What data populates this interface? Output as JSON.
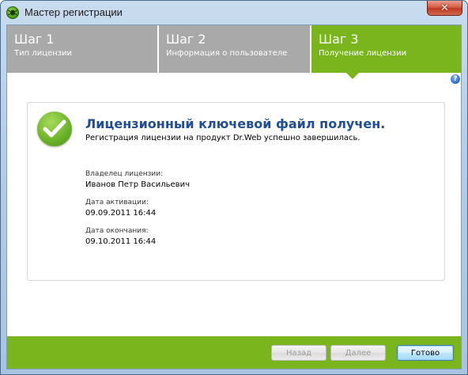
{
  "window": {
    "title": "Мастер регистрации",
    "close_glyph": "✕"
  },
  "steps": [
    {
      "number": "Шаг 1",
      "label": "Тип лицензии",
      "active": false
    },
    {
      "number": "Шаг 2",
      "label": "Информация о пользователе",
      "active": false
    },
    {
      "number": "Шаг 3",
      "label": "Получение лицензии",
      "active": true
    }
  ],
  "help": {
    "glyph": "?"
  },
  "result": {
    "heading": "Лицензионный ключевой файл получен.",
    "subheading": "Регистрация лицензии на продукт Dr.Web успешно завершилась.",
    "owner_label": "Владелец лицензии:",
    "owner_value": "Иванов Петр Васильевич",
    "activation_label": "Дата активации:",
    "activation_value": "09.09.2011 16:44",
    "expiry_label": "Дата окончания:",
    "expiry_value": "09.10.2011 16:44"
  },
  "footer": {
    "back_label": "Назад",
    "next_label": "Далее",
    "done_label": "Готово"
  },
  "colors": {
    "accent_green": "#7ab51d",
    "inactive_step": "#a9a9a9",
    "heading_blue": "#1f4e96"
  },
  "icons": {
    "app": "drweb-spider-icon",
    "status": "check-icon",
    "help": "help-icon",
    "close": "close-icon"
  }
}
